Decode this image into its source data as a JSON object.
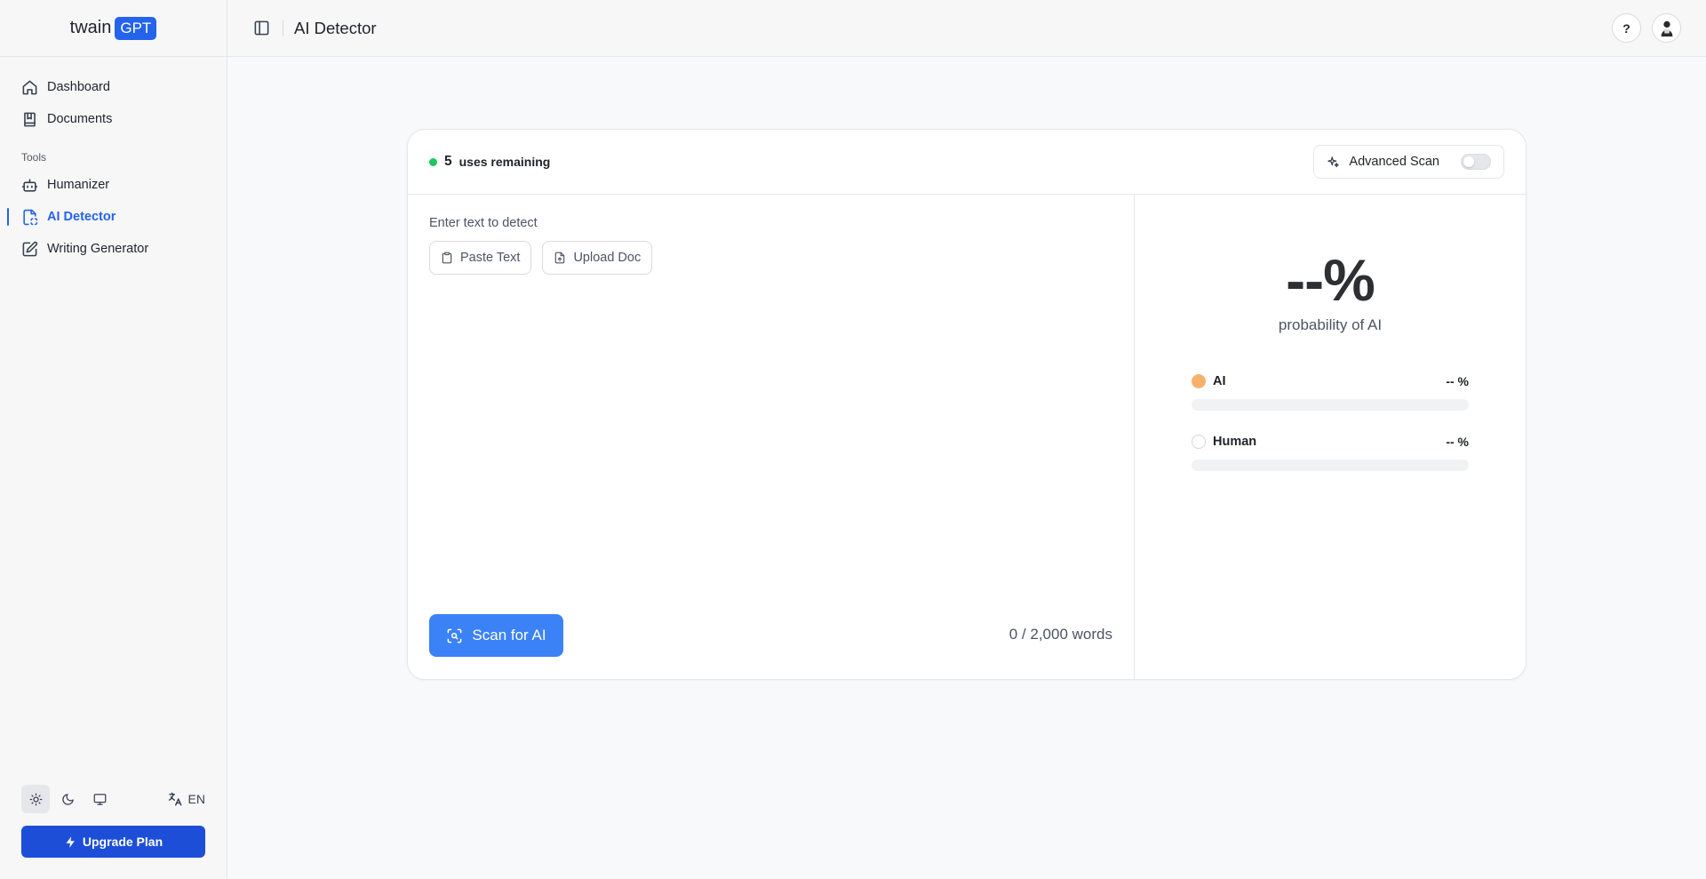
{
  "brand": {
    "name": "twain",
    "badge": "GPT"
  },
  "sidebar": {
    "items": [
      {
        "label": "Dashboard",
        "icon": "home-icon"
      },
      {
        "label": "Documents",
        "icon": "book-icon"
      }
    ],
    "section_label": "Tools",
    "tools": [
      {
        "label": "Humanizer",
        "icon": "bot-icon"
      },
      {
        "label": "AI Detector",
        "icon": "file-scan-icon",
        "active": true
      },
      {
        "label": "Writing Generator",
        "icon": "edit-icon"
      }
    ],
    "theme_options": [
      "sun-icon",
      "moon-icon",
      "monitor-icon"
    ],
    "theme_selected": "light",
    "language": "EN",
    "upgrade_label": "Upgrade Plan"
  },
  "header": {
    "title": "AI Detector",
    "help_label": "?"
  },
  "detector": {
    "uses_count": "5",
    "uses_label": "uses remaining",
    "advanced_scan_label": "Advanced Scan",
    "advanced_scan_enabled": false,
    "input_label": "Enter text to detect",
    "paste_label": "Paste Text",
    "upload_label": "Upload Doc",
    "input_value": "",
    "scan_label": "Scan for AI",
    "word_count": "0 / 2,000 words"
  },
  "result": {
    "probability": "--%",
    "probability_label": "probability of AI",
    "metrics": [
      {
        "label": "AI",
        "value": "-- %",
        "color": "#f6b26b",
        "fill": 0
      },
      {
        "label": "Human",
        "value": "-- %",
        "color": "#ffffff",
        "fill": 0
      }
    ]
  },
  "colors": {
    "accent": "#2563eb",
    "scan_button": "#3b82f6",
    "status_dot": "#22c55e"
  }
}
